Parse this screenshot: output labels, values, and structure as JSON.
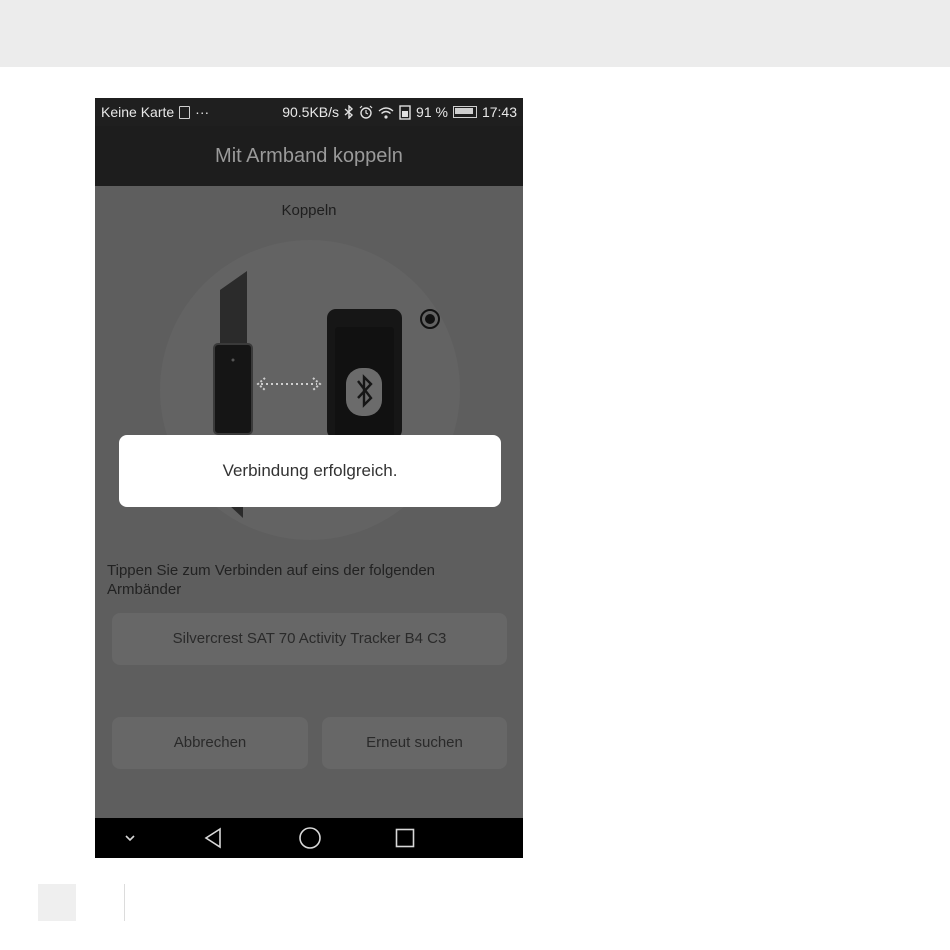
{
  "status_bar": {
    "carrier": "Keine Karte",
    "more": "···",
    "speed": "90.5KB/s",
    "battery_percent": "91 %",
    "time": "17:43"
  },
  "app_bar": {
    "title": "Mit Armband koppeln"
  },
  "pairing": {
    "section_title": "Koppeln",
    "instruction": "Tippen Sie zum Verbinden auf eins der folgenden Armbänder",
    "device_name": "Silvercrest SAT 70 Activity Tracker B4 C3"
  },
  "actions": {
    "cancel_label": "Abbrechen",
    "rescan_label": "Erneut suchen"
  },
  "dialog": {
    "message": "Verbindung erfolgreich."
  },
  "icons": [
    "sim-icon",
    "bluetooth-icon",
    "alarm-icon",
    "wifi-icon",
    "battery-icon",
    "tracker-illustration",
    "phone-illustration",
    "radio-indicator-icon",
    "nav-collapse-icon",
    "nav-back-icon",
    "nav-home-icon",
    "nav-recents-icon"
  ],
  "colors": {
    "overlay_bg": "#5e5e5e",
    "app_bar_bg": "#1d1d1d",
    "dialog_bg": "#ffffff",
    "nav_bar_bg": "#000000"
  }
}
